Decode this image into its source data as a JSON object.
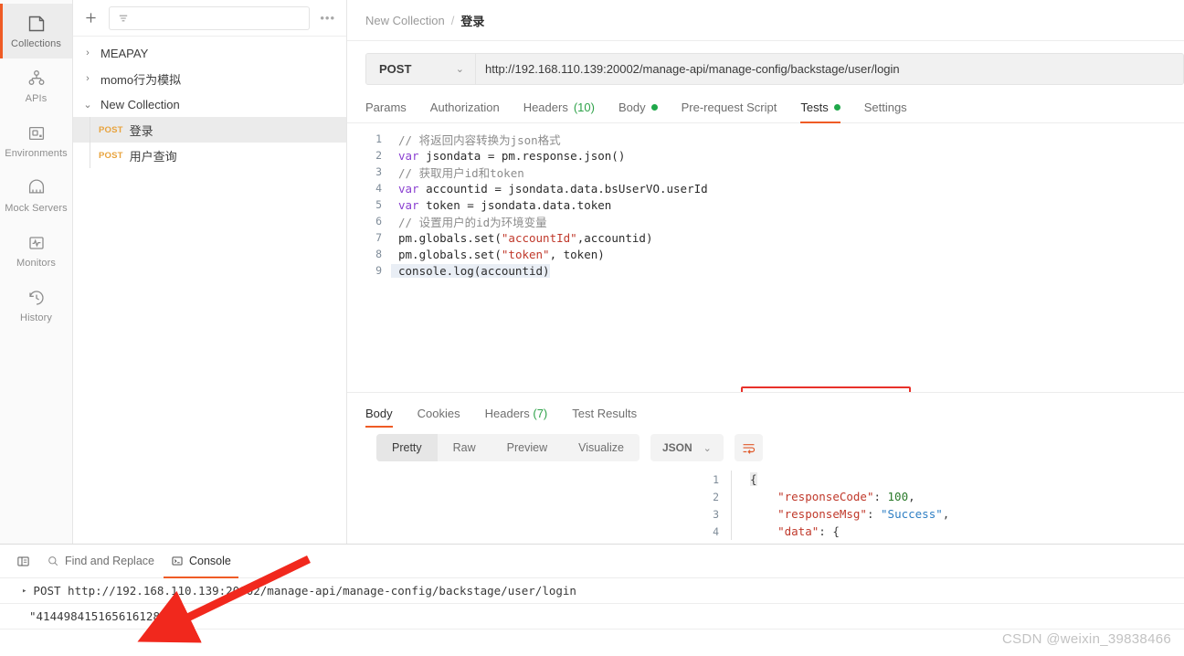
{
  "rail": {
    "items": [
      {
        "label": "Collections",
        "icon": "collections-icon",
        "active": true
      },
      {
        "label": "APIs",
        "icon": "apis-icon",
        "active": false
      },
      {
        "label": "Environments",
        "icon": "environments-icon",
        "active": false
      },
      {
        "label": "Mock Servers",
        "icon": "mock-servers-icon",
        "active": false
      },
      {
        "label": "Monitors",
        "icon": "monitors-icon",
        "active": false
      },
      {
        "label": "History",
        "icon": "history-icon",
        "active": false
      }
    ]
  },
  "sidebar": {
    "new_label": "+",
    "filter_placeholder": "",
    "more_label": "•••",
    "tree": [
      {
        "type": "collection",
        "caret": "›",
        "name": "MEAPAY"
      },
      {
        "type": "collection",
        "caret": "›",
        "name": "momo行为模拟"
      },
      {
        "type": "collection",
        "caret": "⌄",
        "name": "New Collection"
      },
      {
        "type": "request",
        "method": "POST",
        "name": "登录",
        "selected": true
      },
      {
        "type": "request",
        "method": "POST",
        "name": "用户查询",
        "selected": false
      }
    ]
  },
  "breadcrumb": {
    "collection": "New Collection",
    "separator": "/",
    "current": "登录"
  },
  "request": {
    "method": "POST",
    "method_chevron": "⌄",
    "url": "http://192.168.110.139:20002/manage-api/manage-config/backstage/user/login",
    "tabs": [
      {
        "label": "Params",
        "active": false,
        "dot": false
      },
      {
        "label": "Authorization",
        "active": false,
        "dot": false
      },
      {
        "label": "Headers",
        "count": "(10)",
        "active": false,
        "dot": false
      },
      {
        "label": "Body",
        "active": false,
        "dot": true
      },
      {
        "label": "Pre-request Script",
        "active": false,
        "dot": false
      },
      {
        "label": "Tests",
        "active": true,
        "dot": true
      },
      {
        "label": "Settings",
        "active": false,
        "dot": false
      }
    ]
  },
  "editor": {
    "lines": [
      {
        "n": "1",
        "tokens": [
          {
            "t": "// 将返回内容转换为json格式",
            "c": "c-com"
          }
        ]
      },
      {
        "n": "2",
        "tokens": [
          {
            "t": "var",
            "c": "c-kw"
          },
          {
            "t": " jsondata = pm.response.json()",
            "c": "c-plain"
          }
        ]
      },
      {
        "n": "3",
        "tokens": [
          {
            "t": "// 获取用户id和token",
            "c": "c-com"
          }
        ]
      },
      {
        "n": "4",
        "tokens": [
          {
            "t": "var",
            "c": "c-kw"
          },
          {
            "t": " accountid = jsondata.data.bsUserVO.userId",
            "c": "c-plain"
          }
        ]
      },
      {
        "n": "5",
        "tokens": [
          {
            "t": "var",
            "c": "c-kw"
          },
          {
            "t": " token = jsondata.data.token",
            "c": "c-plain"
          }
        ]
      },
      {
        "n": "6",
        "tokens": [
          {
            "t": "// 设置用户的id为环境变量",
            "c": "c-com"
          }
        ]
      },
      {
        "n": "7",
        "tokens": [
          {
            "t": "pm.globals.set(",
            "c": "c-plain"
          },
          {
            "t": "\"accountId\"",
            "c": "c-str"
          },
          {
            "t": ",accountid)",
            "c": "c-plain"
          }
        ]
      },
      {
        "n": "8",
        "tokens": [
          {
            "t": "pm.globals.set(",
            "c": "c-plain"
          },
          {
            "t": "\"token\"",
            "c": "c-str"
          },
          {
            "t": ", token)",
            "c": "c-plain"
          }
        ]
      },
      {
        "n": "9",
        "tokens": [
          {
            "t": "console.log(accountid)",
            "c": "c-plain"
          }
        ]
      }
    ],
    "highlight_line": "9"
  },
  "response": {
    "tabs": [
      {
        "label": "Body",
        "active": true
      },
      {
        "label": "Cookies",
        "active": false
      },
      {
        "label": "Headers",
        "count": "(7)",
        "active": false
      },
      {
        "label": "Test Results",
        "active": false
      }
    ],
    "view_modes": [
      {
        "label": "Pretty",
        "active": true
      },
      {
        "label": "Raw",
        "active": false
      },
      {
        "label": "Preview",
        "active": false
      },
      {
        "label": "Visualize",
        "active": false
      }
    ],
    "format": "JSON",
    "format_chevron": "⌄",
    "wrap_icon": "wrap-lines-icon",
    "body_lines": [
      {
        "n": "1",
        "tokens": [
          {
            "t": "{",
            "c": "j-pun"
          }
        ]
      },
      {
        "n": "2",
        "tokens": [
          {
            "t": "    ",
            "c": "j-pun"
          },
          {
            "t": "\"responseCode\"",
            "c": "j-key"
          },
          {
            "t": ": ",
            "c": "j-pun"
          },
          {
            "t": "100",
            "c": "j-num"
          },
          {
            "t": ",",
            "c": "j-pun"
          }
        ]
      },
      {
        "n": "3",
        "tokens": [
          {
            "t": "    ",
            "c": "j-pun"
          },
          {
            "t": "\"responseMsg\"",
            "c": "j-key"
          },
          {
            "t": ": ",
            "c": "j-pun"
          },
          {
            "t": "\"Success\"",
            "c": "j-str"
          },
          {
            "t": ",",
            "c": "j-pun"
          }
        ]
      },
      {
        "n": "4",
        "tokens": [
          {
            "t": "    ",
            "c": "j-pun"
          },
          {
            "t": "\"data\"",
            "c": "j-key"
          },
          {
            "t": ": {",
            "c": "j-pun"
          }
        ]
      }
    ]
  },
  "console": {
    "toolbar": [
      {
        "label": "",
        "icon": "layout-panel-icon",
        "active": false
      },
      {
        "label": "Find and Replace",
        "icon": "search-icon",
        "active": false
      },
      {
        "label": "Console",
        "icon": "terminal-icon",
        "active": true
      }
    ],
    "lines": [
      {
        "type": "request",
        "triangle": "▸",
        "text": "POST http://192.168.110.139:20002/manage-api/manage-config/backstage/user/login"
      },
      {
        "type": "output",
        "text": "\"414498415165616128\""
      }
    ]
  },
  "watermark": "CSDN @weixin_39838466",
  "colors": {
    "accent": "#ef5b25",
    "method_post": "#e8a33d",
    "status_dot": "#1fa84a",
    "annotation_red": "#e8312a"
  }
}
